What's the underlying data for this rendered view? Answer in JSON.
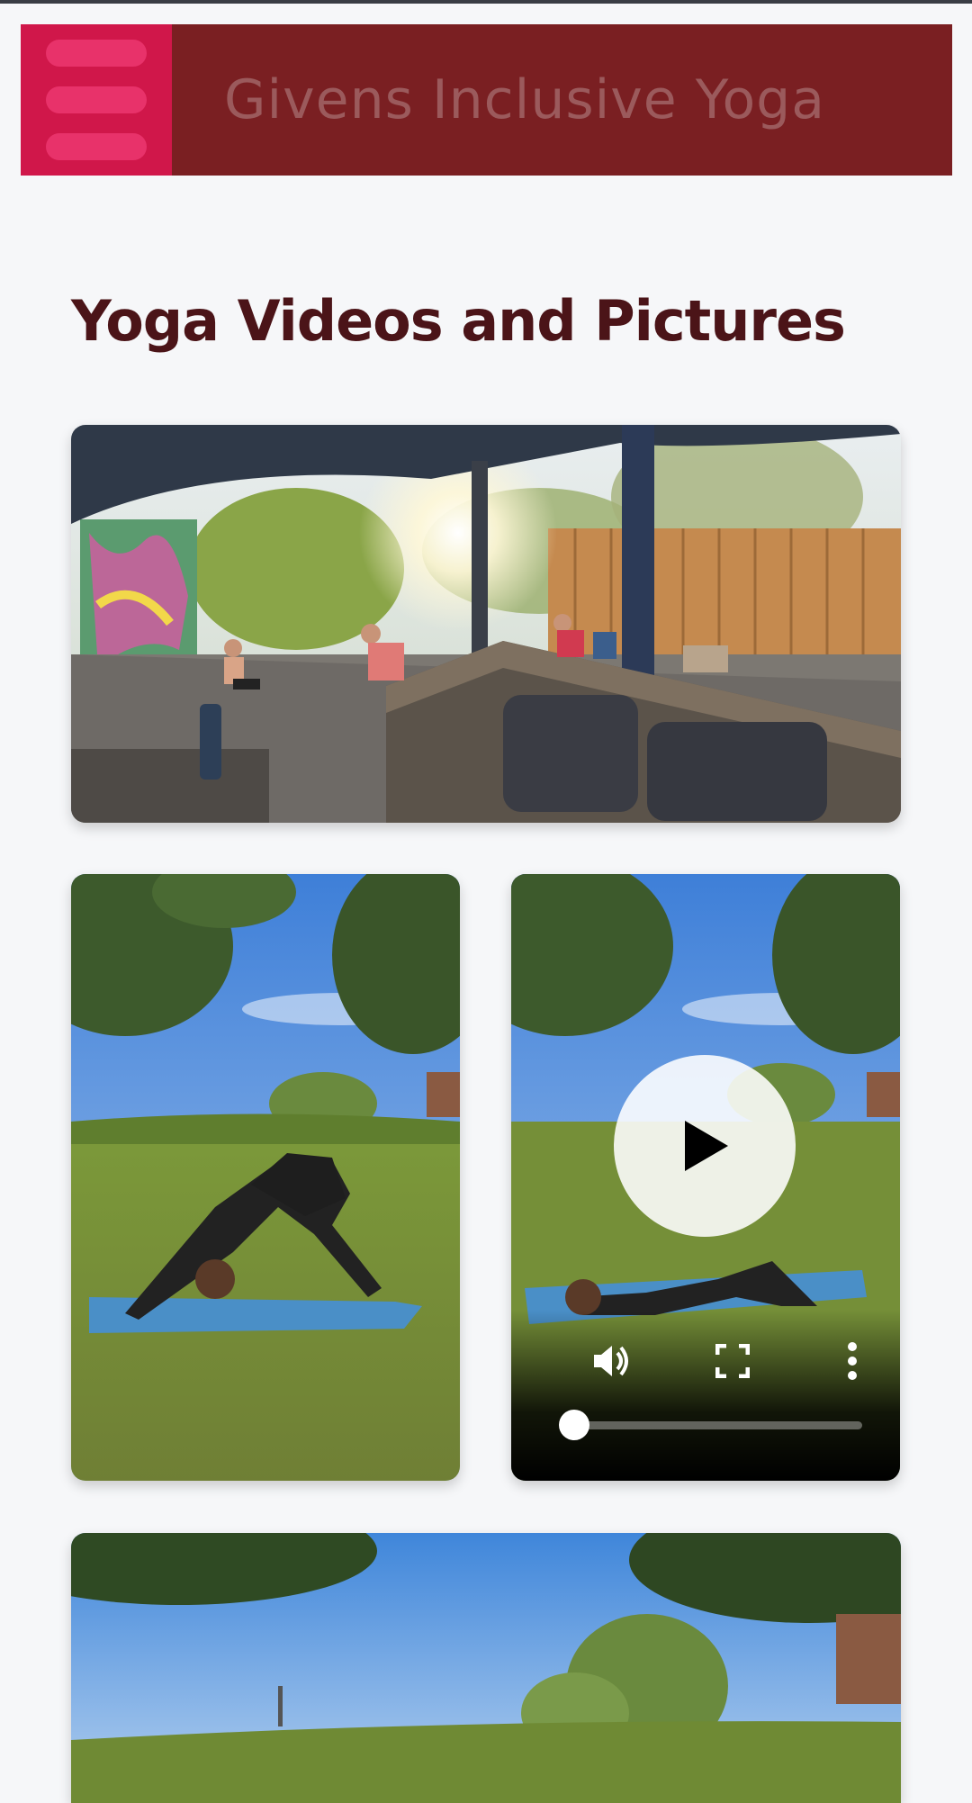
{
  "header": {
    "brand": "Givens Inclusive Yoga",
    "menu_icon": "hamburger-menu-icon",
    "colors": {
      "bar": "#7a1f22",
      "menu_button": "#d0174a"
    }
  },
  "main": {
    "title": "Yoga Videos and Pictures"
  },
  "video": {
    "play_icon": "play-icon",
    "volume_icon": "volume-icon",
    "fullscreen_icon": "fullscreen-icon",
    "more_icon": "more-vertical-icon",
    "progress": 0.03
  }
}
